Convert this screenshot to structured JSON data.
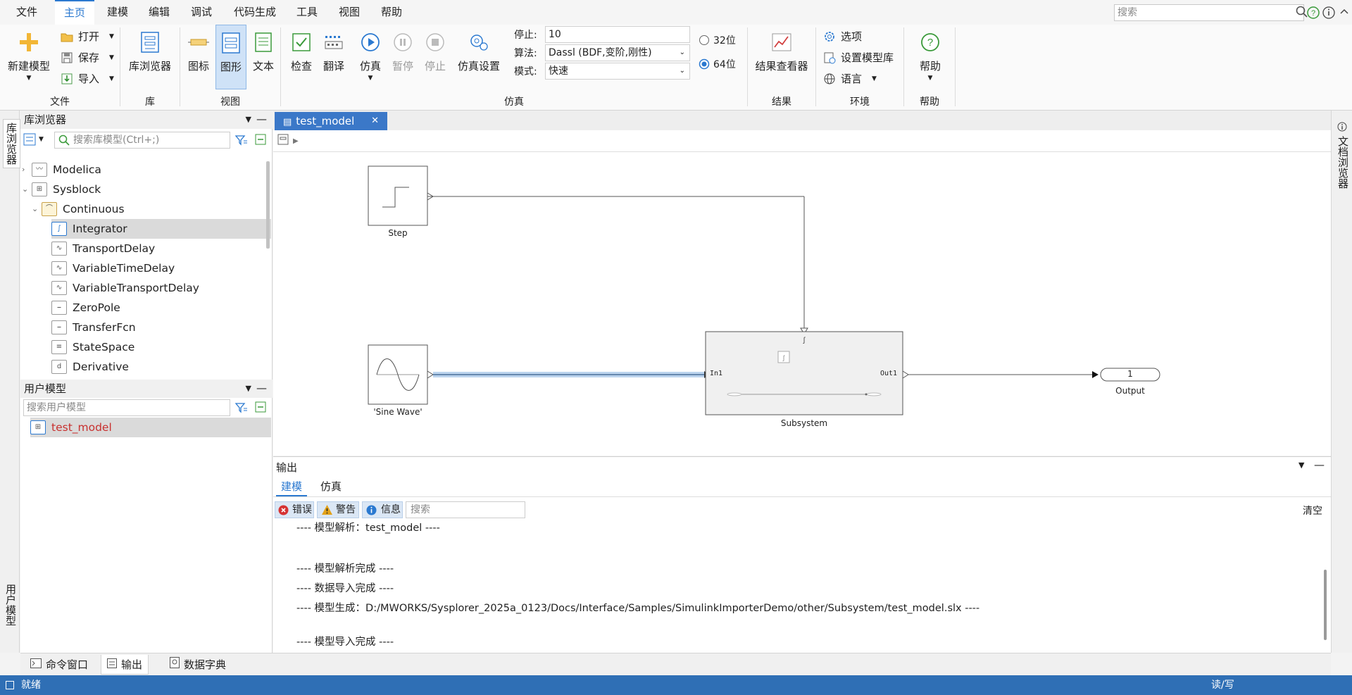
{
  "menu": [
    "文件",
    "主页",
    "建模",
    "编辑",
    "调试",
    "代码生成",
    "工具",
    "视图",
    "帮助"
  ],
  "search_placeholder": "搜索",
  "ribbon": {
    "file": {
      "new_model": "新建模型",
      "open": "打开",
      "save": "保存",
      "import": "导入",
      "group": "文件"
    },
    "lib": {
      "browser": "库浏览器",
      "group": "库"
    },
    "view": {
      "icon": "图标",
      "diagram": "图形",
      "text": "文本",
      "group": "视图"
    },
    "sim": {
      "check": "检查",
      "translate": "翻译",
      "simulate": "仿真",
      "pause": "暂停",
      "stop": "停止",
      "settings": "仿真设置",
      "stop_label": "停止:",
      "stop_value": "10",
      "algo_label": "算法:",
      "algo_value": "Dassl (BDF,变阶,刚性)",
      "mode_label": "模式:",
      "mode_value": "快速",
      "bit32": "32位",
      "bit64": "64位",
      "group": "仿真"
    },
    "result": {
      "viewer": "结果查看器",
      "group": "结果"
    },
    "env": {
      "options": "选项",
      "modlib": "设置模型库",
      "language": "语言",
      "group": "环境"
    },
    "help": {
      "help": "帮助",
      "group": "帮助"
    }
  },
  "left_strip": {
    "lib_browser": "库浏览器",
    "user_model": "用户模型"
  },
  "right_strip": {
    "doc_browser": "文档浏览器"
  },
  "libpanel": {
    "title": "库浏览器",
    "search_placeholder": "搜索库模型(Ctrl+;)",
    "tree": [
      {
        "label": "Modelica"
      },
      {
        "label": "Sysblock"
      },
      {
        "label": "Continuous"
      },
      {
        "label": "Integrator"
      },
      {
        "label": "TransportDelay"
      },
      {
        "label": "VariableTimeDelay"
      },
      {
        "label": "VariableTransportDelay"
      },
      {
        "label": "ZeroPole"
      },
      {
        "label": "TransferFcn"
      },
      {
        "label": "StateSpace"
      },
      {
        "label": "Derivative"
      }
    ]
  },
  "userpanel": {
    "title": "用户模型",
    "search_placeholder": "搜索用户模型",
    "item": "test_model"
  },
  "editor": {
    "tab": "test_model",
    "blocks": {
      "step": "Step",
      "sine": "'Sine Wave'",
      "subsystem": "Subsystem",
      "in_port": "In1",
      "out_port": "Out1",
      "output_value": "1",
      "output": "Output"
    }
  },
  "output": {
    "title": "输出",
    "tabs": [
      "建模",
      "仿真"
    ],
    "filters": {
      "error": "错误",
      "warning": "警告",
      "info": "信息"
    },
    "search_placeholder": "搜索",
    "clear": "清空",
    "lines": [
      "---- 模型解析：test_model ----",
      "---- 模型解析完成 ----",
      "---- 数据导入完成 ----",
      "---- 模型生成：D:/MWORKS/Sysplorer_2025a_0123/Docs/Interface/Samples/SimulinkImporterDemo/other/Subsystem/test_model.slx ----",
      "---- 模型导入完成 ----"
    ]
  },
  "bottom_tabs": [
    "命令窗口",
    "输出",
    "数据字典"
  ],
  "status": {
    "left": "就绪",
    "right": "读/写"
  }
}
